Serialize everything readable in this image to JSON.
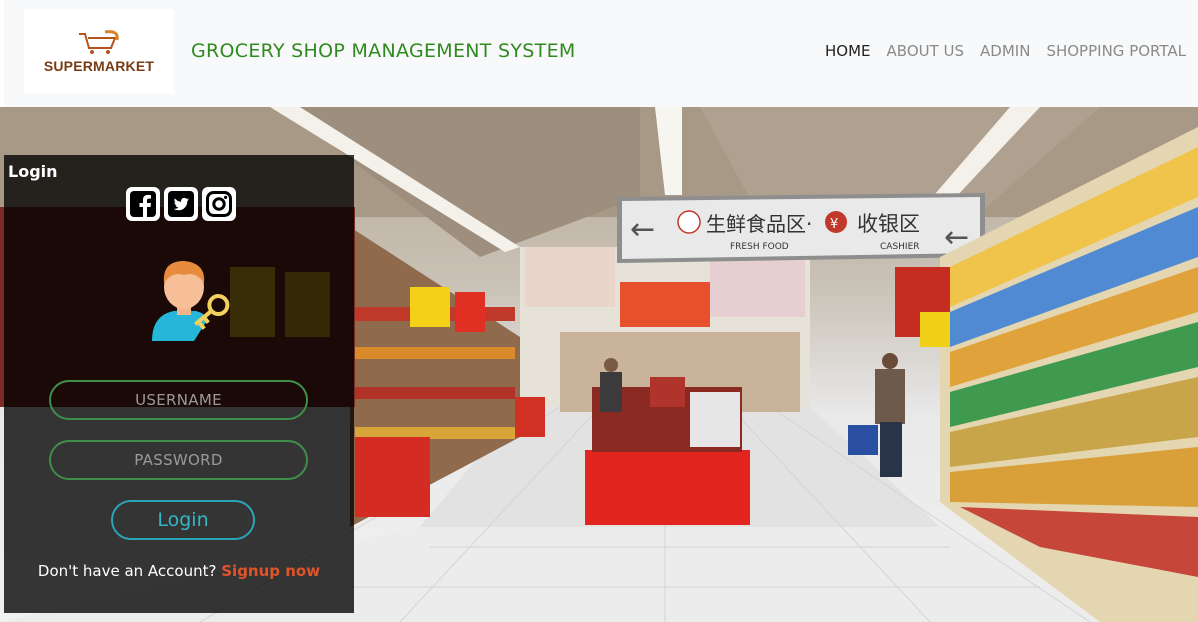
{
  "header": {
    "logo_text": "SUPERMARKET",
    "title": "GROCERY SHOP MANAGEMENT SYSTEM",
    "nav": [
      "HOME",
      "ABOUT US",
      "ADMIN",
      "SHOPPING PORTAL"
    ],
    "active_nav": "HOME"
  },
  "store_signs": {
    "fresh_food_cn": "生鲜食品区·",
    "cashier_cn": "收银区",
    "fresh_food": "FRESH FOOD",
    "cashier": "CASHIER",
    "yuan_symbol": "¥"
  },
  "login": {
    "heading": "Login",
    "social_icons": [
      "facebook-icon",
      "twitter-icon",
      "instagram-icon"
    ],
    "username_placeholder": "USERNAME",
    "password_placeholder": "PASSWORD",
    "button_label": "Login",
    "signup_prompt": "Don't have an Account?",
    "signup_link": "Signup now"
  },
  "colors": {
    "brand_green": "#2f8a1f",
    "field_border": "#3f8f4a",
    "button_teal": "#2aa5b8",
    "signup_orange": "#e0542a"
  }
}
